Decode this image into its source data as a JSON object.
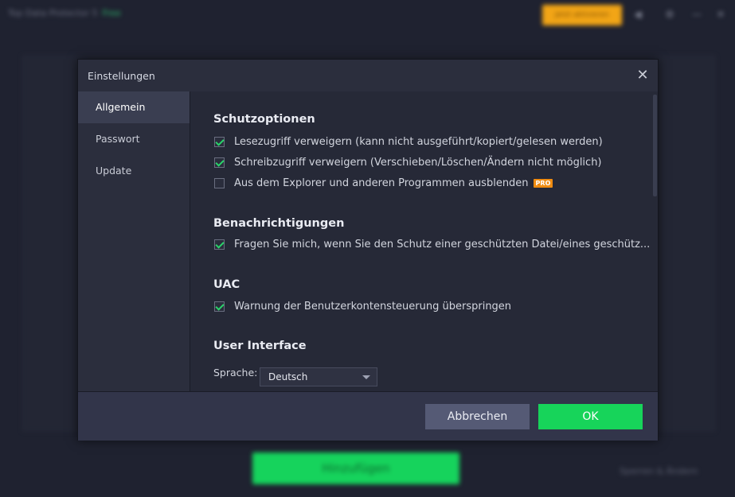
{
  "background": {
    "app_title": "Top Data Protector 5",
    "edition": "Free",
    "upgrade_label": "Jetzt aktivieren",
    "add_button": "Hinzufügen",
    "link_text": "Sperren & Ändern"
  },
  "dialog": {
    "title": "Einstellungen",
    "close_icon": "close-icon",
    "sidebar": [
      "Allgemein",
      "Passwort",
      "Update"
    ],
    "sections": {
      "protection": {
        "heading": "Schutzoptionen",
        "options": [
          {
            "label": "Lesezugriff verweigern (kann nicht ausgeführt/kopiert/gelesen werden)",
            "checked": true
          },
          {
            "label": "Schreibzugriff verweigern (Verschieben/Löschen/Ändern nicht möglich)",
            "checked": true
          },
          {
            "label": "Aus dem Explorer und anderen Programmen ausblenden",
            "checked": false,
            "badge": "PRO"
          }
        ]
      },
      "notifications": {
        "heading": "Benachrichtigungen",
        "options": [
          {
            "label": "Fragen Sie mich, wenn Sie den Schutz einer geschützten Datei/eines geschütz...",
            "checked": true
          }
        ]
      },
      "uac": {
        "heading": "UAC",
        "options": [
          {
            "label": "Warnung der Benutzerkontensteuerung überspringen",
            "checked": true
          }
        ]
      },
      "ui": {
        "heading": "User Interface",
        "language_label": "Sprache:",
        "language_value": "Deutsch"
      }
    },
    "buttons": {
      "cancel": "Abbrechen",
      "ok": "OK"
    }
  },
  "colors": {
    "accent_green": "#17d45a",
    "pro_badge": "#f08c12",
    "upgrade": "#f2a516"
  }
}
